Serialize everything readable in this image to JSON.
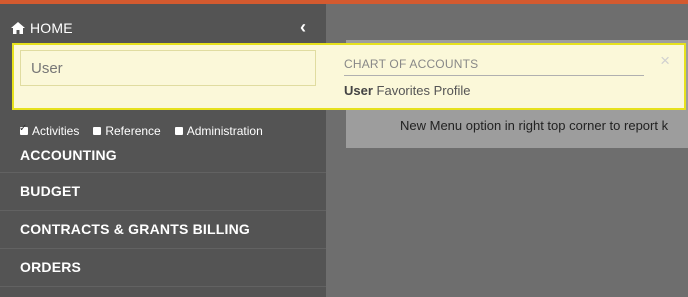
{
  "header": {
    "home_label": "HOME",
    "collapse_glyph": "‹"
  },
  "search": {
    "value": "User",
    "placeholder": ""
  },
  "results": {
    "heading": "CHART OF ACCOUNTS",
    "item_match": "User",
    "item_rest": " Favorites Profile",
    "close_glyph": "×"
  },
  "filters": {
    "activities": "Activities",
    "reference": "Reference",
    "administration": "Administration"
  },
  "menu": {
    "items": [
      {
        "label": "ACCOUNTING"
      },
      {
        "label": "BUDGET"
      },
      {
        "label": "CONTRACTS & GRANTS BILLING"
      },
      {
        "label": "ORDERS"
      }
    ]
  },
  "content": {
    "notice": "New Menu option in right top corner to report k"
  },
  "colors": {
    "accent": "#d45a2f",
    "highlight_border": "#e6e11d",
    "sidebar_bg": "#545454"
  },
  "icons": {
    "home": "home-icon",
    "collapse": "chevron-left-icon",
    "close": "close-icon"
  }
}
